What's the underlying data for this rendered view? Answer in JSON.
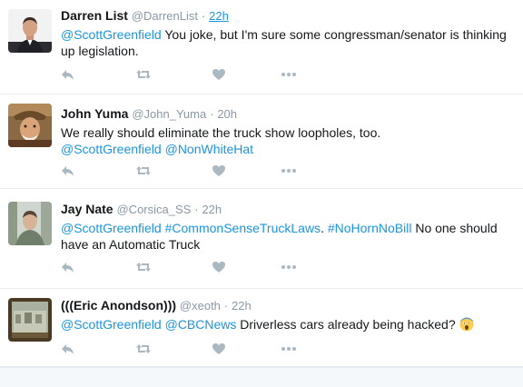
{
  "tweets": [
    {
      "fullname": "Darren List",
      "username": "@DarrenList",
      "sep": "·",
      "time": "22h",
      "text_parts": [
        {
          "type": "mention",
          "text": "@ScottGreenfield"
        },
        {
          "type": "text",
          "text": " You joke, but I'm sure some congressman/senator is thinking up legislation."
        }
      ]
    },
    {
      "fullname": "John Yuma",
      "username": "@John_Yuma",
      "sep": "·",
      "time": "20h",
      "text_parts": [
        {
          "type": "text",
          "text": "We really should eliminate the truck show loopholes, too."
        },
        {
          "type": "br"
        },
        {
          "type": "mention",
          "text": "@ScottGreenfield"
        },
        {
          "type": "text",
          "text": " "
        },
        {
          "type": "mention",
          "text": "@NonWhiteHat"
        }
      ]
    },
    {
      "fullname": "Jay Nate",
      "username": "@Corsica_SS",
      "sep": "·",
      "time": "22h",
      "text_parts": [
        {
          "type": "mention",
          "text": "@ScottGreenfield"
        },
        {
          "type": "text",
          "text": " "
        },
        {
          "type": "hashtag",
          "text": "#CommonSenseTruckLaws"
        },
        {
          "type": "text",
          "text": ". "
        },
        {
          "type": "hashtag",
          "text": "#NoHornNoBill"
        },
        {
          "type": "text",
          "text": " No one should have an Automatic Truck"
        }
      ]
    },
    {
      "fullname": "(((Eric Anondson)))",
      "username": "@xeoth",
      "sep": "·",
      "time": "22h",
      "text_parts": [
        {
          "type": "mention",
          "text": "@ScottGreenfield"
        },
        {
          "type": "text",
          "text": " "
        },
        {
          "type": "mention",
          "text": "@CBCNews"
        },
        {
          "type": "text",
          "text": " Driverless cars already being hacked? "
        },
        {
          "type": "emoji",
          "text": "scream-emoji"
        }
      ]
    }
  ],
  "icons": {
    "reply": "reply-icon",
    "retweet": "retweet-icon",
    "like": "heart-icon",
    "more": "more-icon"
  },
  "colors": {
    "link": "#1b95e0",
    "secondary": "#8899a6",
    "icon": "#aab8c2",
    "text": "#14171a",
    "border": "#e6ecf0"
  }
}
